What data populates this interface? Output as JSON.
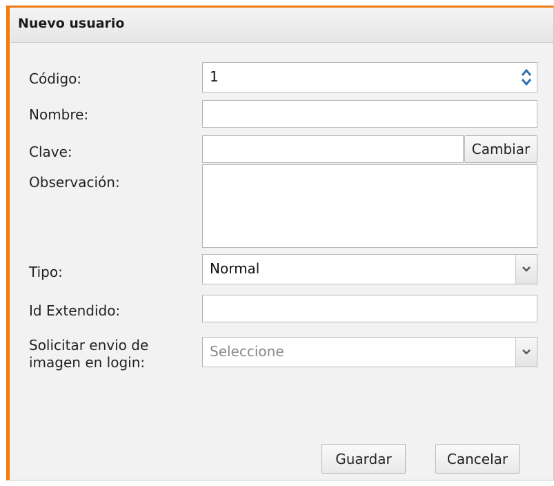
{
  "dialog": {
    "title": "Nuevo usuario",
    "fields": {
      "codigo": {
        "label": "Código:",
        "value": "1"
      },
      "nombre": {
        "label": "Nombre:",
        "value": ""
      },
      "clave": {
        "label": "Clave:",
        "value": "",
        "button_label": "Cambiar"
      },
      "observacion": {
        "label": "Observación:",
        "value": ""
      },
      "tipo": {
        "label": "Tipo:",
        "value": "Normal"
      },
      "id_extendido": {
        "label": "Id Extendido:",
        "value": ""
      },
      "solicitar": {
        "label_line1": "Solicitar envio de",
        "label_line2": "imagen en login:",
        "placeholder": "Seleccione"
      }
    },
    "buttons": {
      "save_label": "Guardar",
      "cancel_label": "Cancelar"
    },
    "colors": {
      "accent_border": "#f07a10",
      "spinner_arrow": "#2a6fb0"
    }
  }
}
